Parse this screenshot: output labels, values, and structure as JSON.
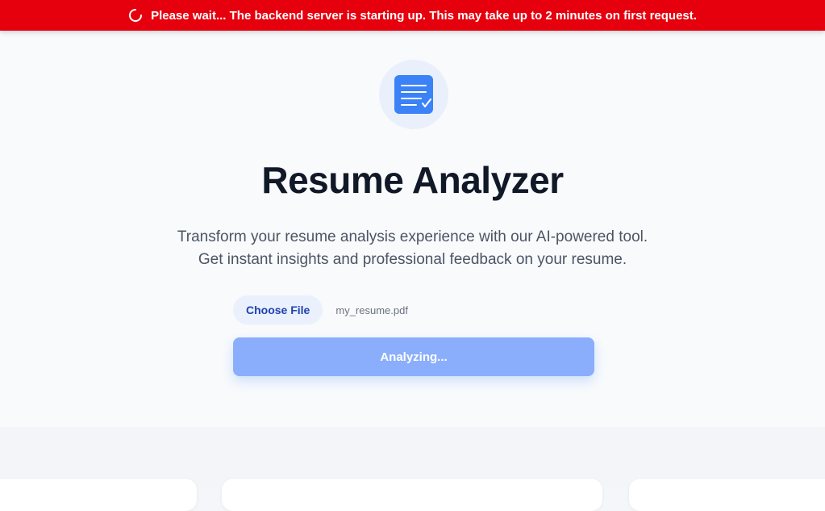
{
  "banner": {
    "icon": "loading-spinner-icon",
    "message": "Please wait... The backend server is starting up. This may take up to 2 minutes on first request.",
    "color": "#e6000d"
  },
  "hero": {
    "logo_icon": "document-check-icon",
    "title": "Resume Analyzer",
    "subtitle_line1": "Transform your resume analysis experience with our AI-powered tool.",
    "subtitle_line2": "Get instant insights and professional feedback on your resume."
  },
  "upload": {
    "choose_file_label": "Choose File",
    "file_name": "my_resume.pdf",
    "analyze_label": "Analyzing...",
    "accent_color": "#3b82f6"
  }
}
